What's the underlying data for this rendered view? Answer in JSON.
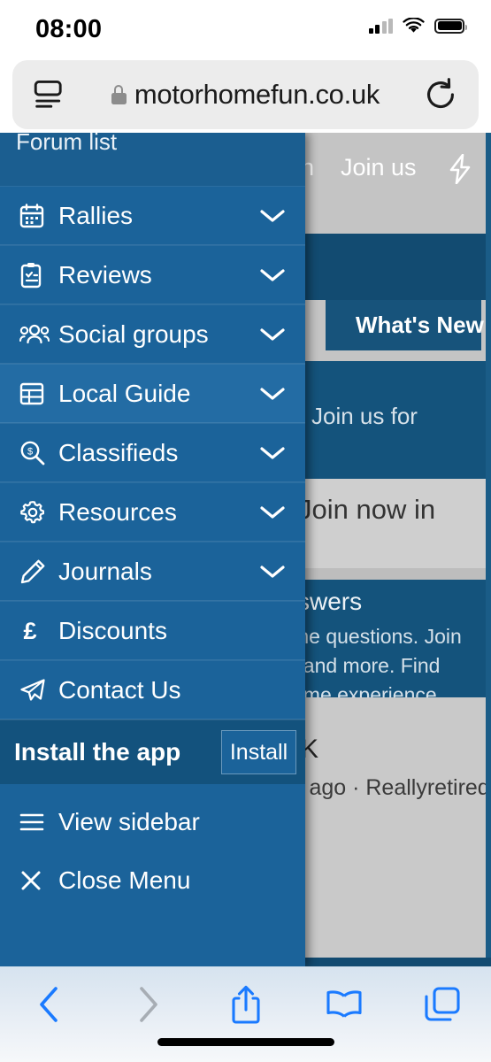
{
  "status_bar": {
    "time": "08:00",
    "signal_icon": "cellular-bars-icon",
    "wifi_icon": "wifi-icon",
    "battery_icon": "battery-full-icon"
  },
  "browser": {
    "page_settings_icon": "page-settings-icon",
    "lock_icon": "lock-icon",
    "url": "motorhomefun.co.uk",
    "reload_icon": "reload-icon",
    "toolbar": {
      "back_label": "Back",
      "forward_label": "Forward",
      "share_label": "Share",
      "bookmarks_label": "Bookmarks",
      "tabs_label": "Tabs"
    }
  },
  "menu": {
    "header_label": "Forum list",
    "items": [
      {
        "label": "Rallies",
        "icon": "calendar-icon",
        "has_chevron": true,
        "active": false
      },
      {
        "label": "Reviews",
        "icon": "clipboard-check-icon",
        "has_chevron": true,
        "active": false
      },
      {
        "label": "Social groups",
        "icon": "users-icon",
        "has_chevron": true,
        "active": false
      },
      {
        "label": "Local Guide",
        "icon": "table-icon",
        "has_chevron": true,
        "active": true
      },
      {
        "label": "Classifieds",
        "icon": "search-dollar-icon",
        "has_chevron": true,
        "active": false
      },
      {
        "label": "Resources",
        "icon": "gear-icon",
        "has_chevron": true,
        "active": false
      },
      {
        "label": "Journals",
        "icon": "pencil-icon",
        "has_chevron": true,
        "active": false
      },
      {
        "label": "Discounts",
        "icon": "pound-sign-icon",
        "has_chevron": false,
        "active": false
      },
      {
        "label": "Contact Us",
        "icon": "paper-plane-icon",
        "has_chevron": false,
        "active": false
      }
    ],
    "install": {
      "label": "Install the app",
      "button_label": "Install"
    },
    "footer_items": [
      {
        "label": "View sidebar",
        "icon": "hamburger-icon"
      },
      {
        "label": "Close Menu",
        "icon": "close-icon"
      }
    ]
  },
  "background_page": {
    "nav_signin_fragment": "in",
    "nav_join_us": "Join us",
    "nav_bolt_icon": "bolt-icon",
    "whats_new_button": "What's New",
    "whats_new_icon": "bolt-icon",
    "join_us_for": "Join us for",
    "join_now_in": "Join now in",
    "answers_heading": "swers",
    "paragraph_line1": "me questions. Join",
    "paragraph_line2": ", and more. Find",
    "paragraph_line3": "ome experience.",
    "thread_title_fragment": "K",
    "thread_meta": "s ago · Reallyretired"
  },
  "colors": {
    "menu_blue": "#1b639a",
    "menu_active_blue": "#236ca4",
    "nav_navy": "#14537c",
    "page_gray": "#c4c4c4",
    "safari_blue": "#1a7aff",
    "forward_disabled": "#a7adb4"
  }
}
